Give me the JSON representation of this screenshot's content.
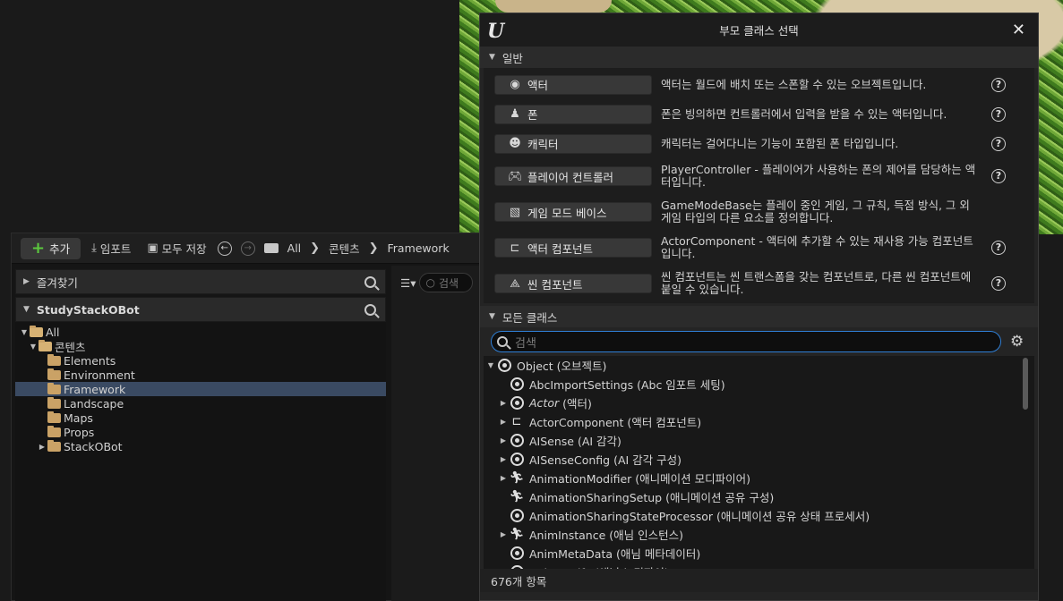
{
  "content_browser": {
    "toolbar": {
      "add_label": "추가",
      "import_label": "임포트",
      "save_all_label": "모두 저장",
      "breadcrumb": [
        "All",
        "콘텐츠",
        "Framework"
      ]
    },
    "favorites": {
      "title": "즐겨찾기"
    },
    "project": {
      "title": "StudyStackOBot"
    },
    "tree": [
      {
        "label": "All",
        "depth": 0,
        "expanded": true,
        "selected": false
      },
      {
        "label": "콘텐츠",
        "depth": 1,
        "expanded": true,
        "selected": false
      },
      {
        "label": "Elements",
        "depth": 2,
        "expanded": false,
        "selected": false
      },
      {
        "label": "Environment",
        "depth": 2,
        "expanded": false,
        "selected": false
      },
      {
        "label": "Framework",
        "depth": 2,
        "expanded": false,
        "selected": true
      },
      {
        "label": "Landscape",
        "depth": 2,
        "expanded": false,
        "selected": false
      },
      {
        "label": "Maps",
        "depth": 2,
        "expanded": false,
        "selected": false
      },
      {
        "label": "Props",
        "depth": 2,
        "expanded": false,
        "selected": false
      },
      {
        "label": "StackOBot",
        "depth": 2,
        "expanded": false,
        "selected": false,
        "has_children": true
      }
    ],
    "right_search_placeholder": "검색"
  },
  "dialog": {
    "title": "부모 클래스 선택",
    "common_section": "일반",
    "common_classes": [
      {
        "label": "액터",
        "icon": "sphere-icon",
        "description": "액터는 월드에 배치 또는 스폰할 수 있는 오브젝트입니다."
      },
      {
        "label": "폰",
        "icon": "pawn-icon",
        "description": "폰은 빙의하면 컨트롤러에서 입력을 받을 수 있는 액터입니다."
      },
      {
        "label": "캐릭터",
        "icon": "character-icon",
        "description": "캐릭터는 걸어다니는 기능이 포함된 폰 타입입니다."
      },
      {
        "label": "플레이어 컨트롤러",
        "icon": "gamepad-icon",
        "description": "PlayerController - 플레이어가 사용하는 폰의 제어를 담당하는 액터입니다."
      },
      {
        "label": "게임 모드 베이스",
        "icon": "image-icon",
        "description": "GameModeBase는 플레이 중인 게임, 그 규칙, 득점 방식, 그 외 게임 타입의 다른 요소를 정의합니다."
      },
      {
        "label": "액터 컴포넌트",
        "icon": "component-icon",
        "description": "ActorComponent - 액터에 추가할 수 있는 재사용 가능 컴포넌트입니다."
      },
      {
        "label": "씬 컴포넌트",
        "icon": "scene-component-icon",
        "description": "씬 컴포넌트는 씬 트랜스폼을 갖는 컴포넌트로, 다른 씬 컴포넌트에 붙일 수 있습니다."
      }
    ],
    "all_section": "모든 클래스",
    "search_placeholder": "검색",
    "class_tree": [
      {
        "label": "Object (오브젝트)",
        "indent": 0,
        "arrow": "down",
        "icon": "object-icon",
        "italic": false
      },
      {
        "label": "AbcImportSettings (Abc 임포트 세팅)",
        "indent": 1,
        "arrow": "",
        "icon": "object-icon",
        "italic": false
      },
      {
        "label": "Actor",
        "suffix": " (액터)",
        "indent": 1,
        "arrow": "right",
        "icon": "object-icon",
        "italic": true
      },
      {
        "label": "ActorComponent (액터 컴포넌트)",
        "indent": 1,
        "arrow": "right",
        "icon": "component-icon",
        "italic": false
      },
      {
        "label": "AISense (AI 감각)",
        "indent": 1,
        "arrow": "right",
        "icon": "object-icon",
        "italic": false
      },
      {
        "label": "AISenseConfig (AI 감각 구성)",
        "indent": 1,
        "arrow": "right",
        "icon": "object-icon",
        "italic": false
      },
      {
        "label": "AnimationModifier (애니메이션 모디파이어)",
        "indent": 1,
        "arrow": "right",
        "icon": "running-figure-icon",
        "italic": false
      },
      {
        "label": "AnimationSharingSetup (애니메이션 공유 구성)",
        "indent": 1,
        "arrow": "",
        "icon": "running-figure-icon",
        "italic": false
      },
      {
        "label": "AnimationSharingStateProcessor (애니메이션 공유 상태 프로세서)",
        "indent": 1,
        "arrow": "",
        "icon": "object-icon",
        "italic": false
      },
      {
        "label": "AnimInstance (애님 인스턴스)",
        "indent": 1,
        "arrow": "right",
        "icon": "running-figure-icon",
        "italic": false
      },
      {
        "label": "AnimMetaData (애님 메타데이터)",
        "indent": 1,
        "arrow": "",
        "icon": "object-icon",
        "italic": false
      },
      {
        "label": "AnimNotify (애님 노티파이)",
        "indent": 1,
        "arrow": "right",
        "icon": "object-icon",
        "italic": false
      }
    ],
    "item_count": "676개 항목"
  }
}
